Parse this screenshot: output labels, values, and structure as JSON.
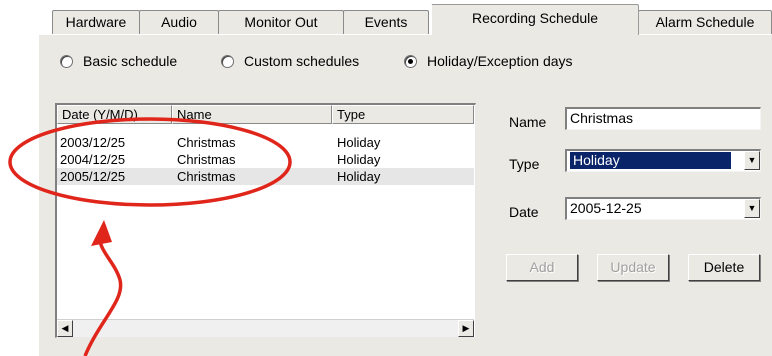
{
  "tabs": [
    {
      "label": "Hardware"
    },
    {
      "label": "Audio"
    },
    {
      "label": "Monitor Out"
    },
    {
      "label": "Events"
    },
    {
      "label": "Recording Schedule",
      "active": true
    },
    {
      "label": "Alarm Schedule"
    }
  ],
  "schedule_mode": {
    "options": [
      "Basic schedule",
      "Custom schedules",
      "Holiday/Exception days"
    ],
    "selected": "Holiday/Exception days"
  },
  "list": {
    "columns": [
      "Date (Y/M/D)",
      "Name",
      "Type"
    ],
    "rows": [
      {
        "date": "2003/12/25",
        "name": "Christmas",
        "type": "Holiday"
      },
      {
        "date": "2004/12/25",
        "name": "Christmas",
        "type": "Holiday"
      },
      {
        "date": "2005/12/25",
        "name": "Christmas",
        "type": "Holiday",
        "selected": true
      }
    ]
  },
  "form": {
    "name_label": "Name",
    "name_value": "Christmas",
    "type_label": "Type",
    "type_value": "Holiday",
    "date_label": "Date",
    "date_value": "2005-12-25"
  },
  "buttons": {
    "add": "Add",
    "update": "Update",
    "delete": "Delete"
  },
  "colors": {
    "annotation": "#e0251b",
    "selection": "#0a246a",
    "panel": "#ebe9e4"
  },
  "icons": {
    "scroll_left": "left-arrow-icon",
    "scroll_right": "right-arrow-icon",
    "dropdown": "chevron-down-icon"
  }
}
